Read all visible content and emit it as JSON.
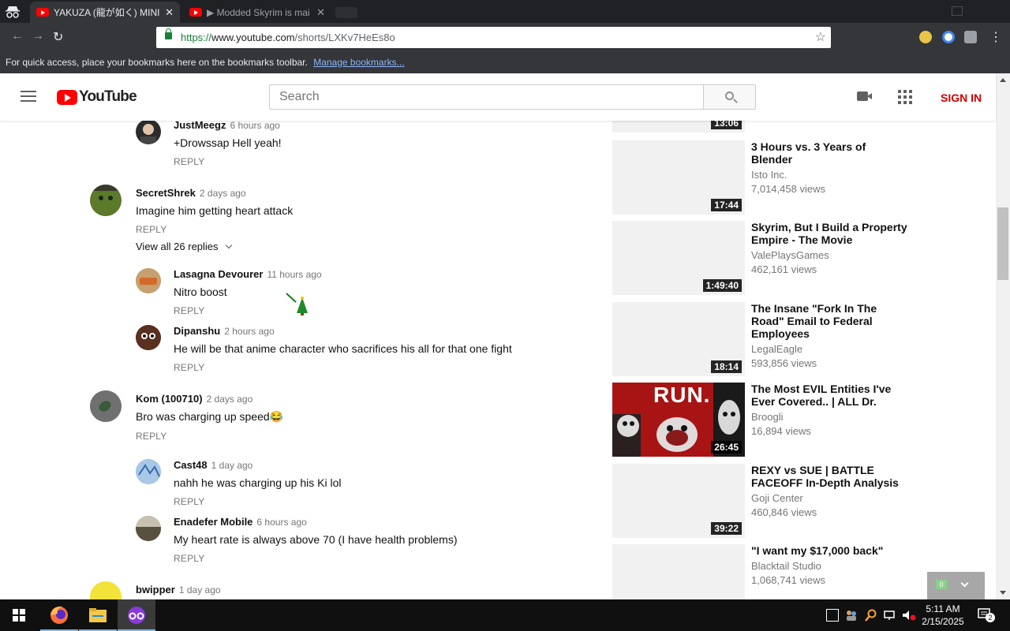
{
  "browser": {
    "tabs": [
      {
        "title": "YAKUZA (龍が如く) MINIGA",
        "active": true
      },
      {
        "title": "▶ Modded Skyrim is mai",
        "active": false
      }
    ],
    "url_scheme": "https://",
    "url_host": "www.youtube.com",
    "url_path": "/shorts/LXKv7HeEs8o",
    "bookmarks_text": "For quick access, place your bookmarks here on the bookmarks toolbar.",
    "bookmarks_link": "Manage bookmarks..."
  },
  "header": {
    "logo_text": "YouTube",
    "search_placeholder": "Search",
    "signin_label": "SIGN IN"
  },
  "comments": [
    {
      "author": "JustMeegz",
      "time": "6 hours ago",
      "text": "+Drowssap Hell yeah!",
      "reply": "REPLY"
    },
    {
      "author": "SecretShrek",
      "time": "2 days ago",
      "text": "Imagine him getting heart attack",
      "reply": "REPLY"
    },
    {
      "author": "Lasagna Devourer",
      "time": "11 hours ago",
      "text": "Nitro boost",
      "reply": "REPLY"
    },
    {
      "author": "Dipanshu",
      "time": "2 hours ago",
      "text": "He will be that anime character who sacrifices his all for that one fight",
      "reply": "REPLY"
    },
    {
      "author": "Kom (100710)",
      "time": "2 days ago",
      "text": "Bro was charging up speed😂",
      "reply": "REPLY"
    },
    {
      "author": "Cast48",
      "time": "1 day ago",
      "text": "nahh he was charging up his Ki lol",
      "reply": "REPLY"
    },
    {
      "author": "Enadefer Mobile",
      "time": "6 hours ago",
      "text": "My heart rate is always above 70 (I have health problems)",
      "reply": "REPLY"
    },
    {
      "author": "bwipper",
      "time": "1 day ago"
    }
  ],
  "view_replies": "View all 26 replies",
  "sidebar": {
    "top_duration": "13:06",
    "videos": [
      {
        "title": "3 Hours vs. 3 Years of Blender",
        "channel": "Isto Inc.",
        "views": "7,014,458 views",
        "duration": "17:44"
      },
      {
        "title": "Skyrim, But I Build a Property Empire - The Movie",
        "channel": "ValePlaysGames",
        "views": "462,161 views",
        "duration": "1:49:40"
      },
      {
        "title": "The Insane \"Fork In The Road\" Email to Federal Employees",
        "channel": "LegalEagle",
        "views": "593,856 views",
        "duration": "18:14"
      },
      {
        "title": "The Most EVIL Entities I've Ever Covered.. | ALL Dr.",
        "channel": "Broogli",
        "views": "16,894 views",
        "duration": "26:45",
        "thumb_text": "RUN."
      },
      {
        "title": "REXY vs SUE | BATTLE FACEOFF In-Depth Analysis",
        "channel": "Goji Center",
        "views": "460,846 views",
        "duration": "39:22"
      },
      {
        "title": "\"I want my $17,000 back\"",
        "channel": "Blacktail Studio",
        "views": "1,068,741 views"
      }
    ]
  },
  "widget": {
    "badge": "0"
  },
  "taskbar": {
    "time": "5:11 AM",
    "date": "2/15/2025",
    "notifications": "2"
  }
}
